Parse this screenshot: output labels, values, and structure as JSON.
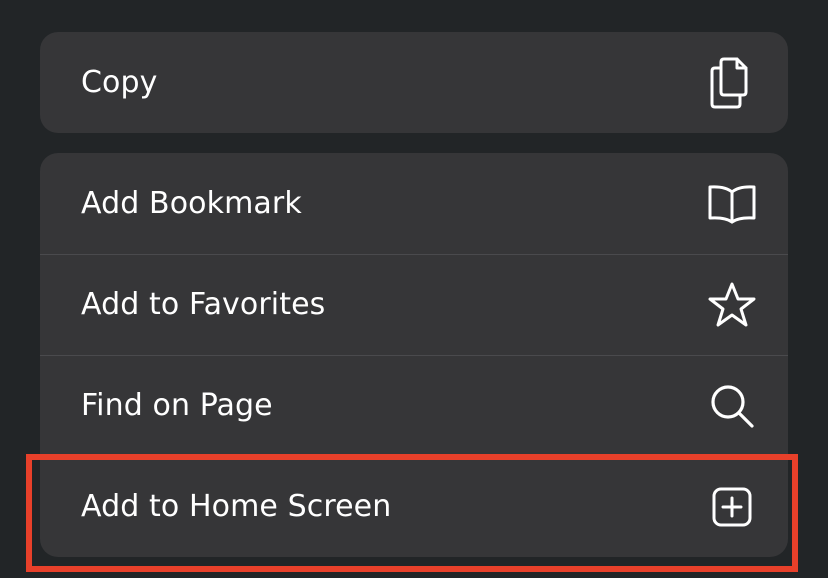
{
  "menu": {
    "copy_group": [
      {
        "label": "Copy",
        "icon": "copy-icon"
      }
    ],
    "main_group": [
      {
        "label": "Add Bookmark",
        "icon": "book-icon"
      },
      {
        "label": "Add to Favorites",
        "icon": "star-icon"
      },
      {
        "label": "Find on Page",
        "icon": "search-icon"
      },
      {
        "label": "Add to Home Screen",
        "icon": "plus-square-icon"
      }
    ]
  },
  "highlight": {
    "target": "Add to Home Screen",
    "color": "#e8402a"
  },
  "colors": {
    "background": "#222527",
    "menu_surface": "#363638",
    "separator": "#4a4a4d",
    "text": "#ffffff"
  }
}
